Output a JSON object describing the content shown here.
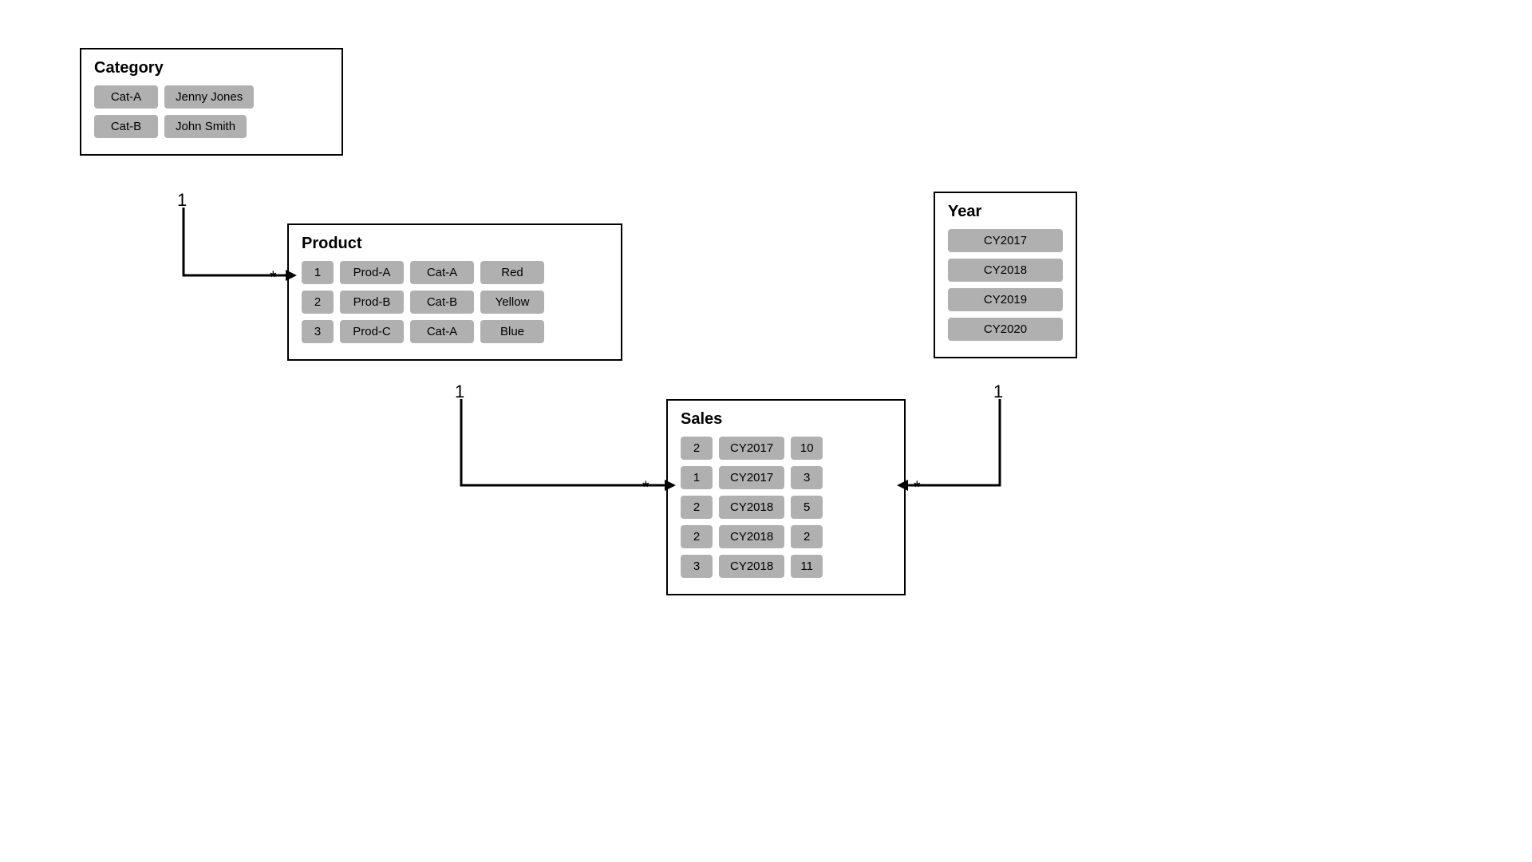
{
  "category": {
    "title": "Category",
    "rows": [
      [
        "Cat-A",
        "Jenny Jones"
      ],
      [
        "Cat-B",
        "John Smith"
      ]
    ]
  },
  "product": {
    "title": "Product",
    "rows": [
      [
        "1",
        "Prod-A",
        "Cat-A",
        "Red"
      ],
      [
        "2",
        "Prod-B",
        "Cat-B",
        "Yellow"
      ],
      [
        "3",
        "Prod-C",
        "Cat-A",
        "Blue"
      ]
    ]
  },
  "year": {
    "title": "Year",
    "rows": [
      "CY2017",
      "CY2018",
      "CY2019",
      "CY2020"
    ]
  },
  "sales": {
    "title": "Sales",
    "rows": [
      [
        "2",
        "CY2017",
        "10"
      ],
      [
        "1",
        "CY2017",
        "3"
      ],
      [
        "2",
        "CY2018",
        "5"
      ],
      [
        "2",
        "CY2018",
        "2"
      ],
      [
        "3",
        "CY2018",
        "11"
      ]
    ]
  },
  "relations": {
    "cat_to_prod_one": "1",
    "cat_to_prod_many": "*",
    "prod_to_sales_one": "1",
    "prod_to_sales_many": "*",
    "year_to_sales_one": "1",
    "year_to_sales_many": "*"
  }
}
